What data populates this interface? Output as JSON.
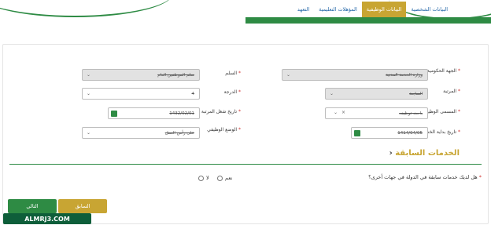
{
  "tabs": [
    {
      "label": "البيانات الشخصية",
      "active": false
    },
    {
      "label": "البيانات الوظيفية",
      "active": true
    },
    {
      "label": "المؤهلات التعليمية",
      "active": false
    },
    {
      "label": "التعهد",
      "active": false
    }
  ],
  "fields": {
    "gov_entity": {
      "label": "الجهة الحكومية",
      "value": "وزارة الخدمة المدنية"
    },
    "ladder": {
      "label": "السلم",
      "value": "سلم الموظفين العام"
    },
    "rank": {
      "label": "المرتبة",
      "value": "السابعة"
    },
    "grade": {
      "label": "الدرجة",
      "value": "4"
    },
    "job_title": {
      "label": "المسمى الوظيفي",
      "value": "باحث توظيف"
    },
    "rank_date": {
      "label": "تاريخ شغل المرتبة",
      "value": "1432/02/01"
    },
    "service_start": {
      "label": "تاريخ بداية الخدمة",
      "value": "1414/04/05"
    },
    "job_status": {
      "label": "الوضع الوظيفي",
      "value": "على رأس العمل"
    }
  },
  "section": {
    "title": "الخدمات السابقة"
  },
  "question": {
    "text": "هل لديك خدمات سابقة في الدولة في جهات أخرى؟",
    "yes": "نعم",
    "no": "لا"
  },
  "buttons": {
    "previous": "السابق",
    "next": "التالي"
  },
  "watermark": "ALMRJ3.COM",
  "colors": {
    "green": "#2e8b44",
    "gold": "#c8a533",
    "link": "#1d62a5",
    "required": "#d0312d"
  }
}
